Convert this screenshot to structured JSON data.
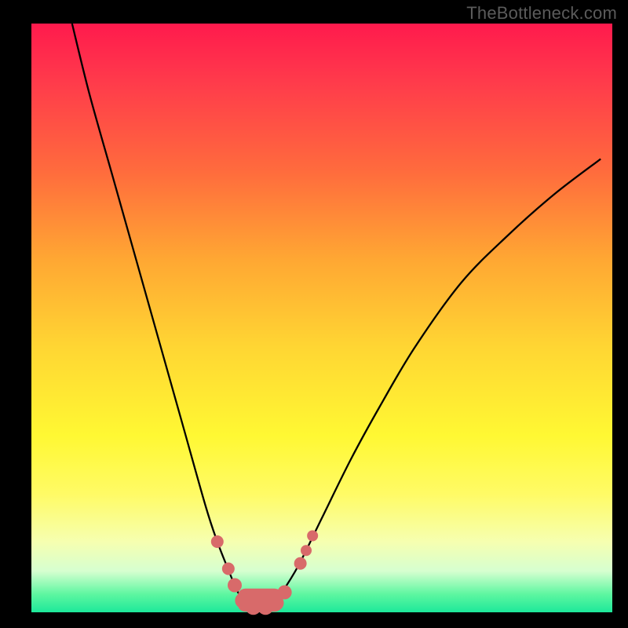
{
  "watermark": "TheBottleneck.com",
  "colors": {
    "curve": "#000000",
    "markers": "#d86a6a",
    "gradient_top": "#ff1a4d",
    "gradient_bottom": "#1de89a"
  },
  "chart_data": {
    "type": "line",
    "title": "",
    "xlabel": "",
    "ylabel": "",
    "xlim": [
      0,
      100
    ],
    "ylim": [
      0,
      100
    ],
    "series": [
      {
        "name": "bottleneck-curve",
        "x": [
          7,
          10,
          14,
          18,
          22,
          26,
          30,
          32,
          34,
          35.5,
          37,
          38.5,
          40,
          41.5,
          43,
          46,
          50,
          55,
          60,
          66,
          74,
          82,
          90,
          98
        ],
        "y": [
          100,
          88,
          74,
          60,
          46,
          32,
          18,
          12,
          7,
          3.5,
          1.5,
          0.8,
          0.8,
          1.5,
          3.2,
          8,
          16,
          26,
          35,
          45,
          56,
          64,
          71,
          77
        ]
      }
    ],
    "markers": [
      {
        "x": 32,
        "y": 12,
        "r": 8
      },
      {
        "x": 33.9,
        "y": 7.4,
        "r": 8
      },
      {
        "x": 35,
        "y": 4.6,
        "r": 9
      },
      {
        "x": 36.4,
        "y": 2.0,
        "r": 10
      },
      {
        "x": 38.2,
        "y": 0.9,
        "r": 10
      },
      {
        "x": 40.3,
        "y": 0.9,
        "r": 10
      },
      {
        "x": 42.1,
        "y": 1.6,
        "r": 10
      },
      {
        "x": 43.6,
        "y": 3.4,
        "r": 9
      },
      {
        "x": 46.3,
        "y": 8.3,
        "r": 8
      },
      {
        "x": 47.3,
        "y": 10.5,
        "r": 7
      },
      {
        "x": 48.4,
        "y": 13.0,
        "r": 7
      }
    ],
    "bottom_blob": {
      "x_start": 35.5,
      "x_end": 43.2,
      "y": 0.9,
      "height": 2.6
    }
  }
}
